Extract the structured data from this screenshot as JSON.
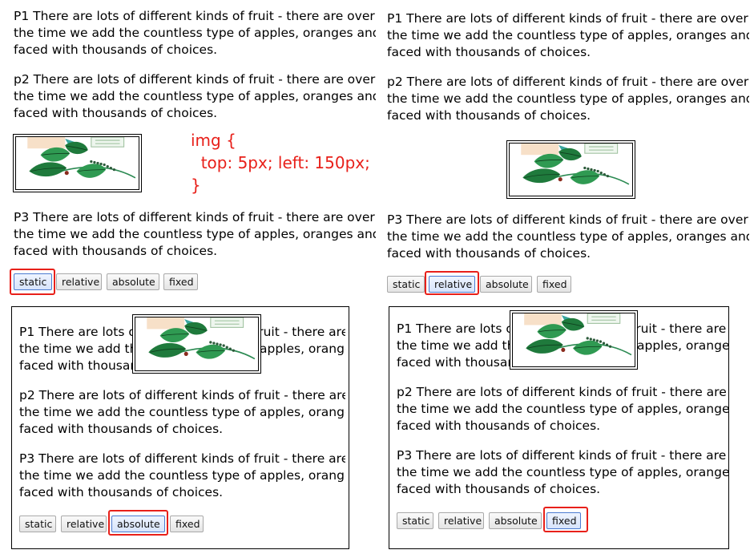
{
  "paragraphs": {
    "p1": {
      "line1": "P1 There are lots of different kinds of fruit - there are over",
      "line2": "the time we add the countless type of apples, oranges and",
      "line3": "faced with thousands of choices."
    },
    "p2": {
      "line1": "p2 There are lots of different kinds of fruit - there are over",
      "line2": "the time we add the countless type of apples, oranges and",
      "line3": "faced with thousands of choices."
    },
    "p3": {
      "line1": "P3 There are lots of different kinds of fruit - there are over",
      "line2": "the time we add the countless type of apples, oranges and",
      "line3": "faced with thousands of choices."
    }
  },
  "code_note": {
    "line1": "img {",
    "line2": "  top: 5px; left: 150px;",
    "line3": "}"
  },
  "buttons": {
    "static": "static",
    "relative": "relative",
    "absolute": "absolute",
    "fixed": "fixed"
  },
  "panels": {
    "top_left": {
      "active_button": "static"
    },
    "top_right": {
      "active_button": "relative"
    },
    "bottom_left": {
      "active_button": "absolute"
    },
    "bottom_right": {
      "active_button": "fixed"
    }
  },
  "image": {
    "icon": "leaf-illustration-icon"
  },
  "colors": {
    "highlight": "#e8201a",
    "code_text": "#e8201a",
    "leaf_dark": "#1f7a3c",
    "leaf_light": "#2f9a52",
    "stem": "#2b8a52",
    "accent_peach": "#f7e0c8",
    "accent_teal": "#3aa6a0"
  }
}
